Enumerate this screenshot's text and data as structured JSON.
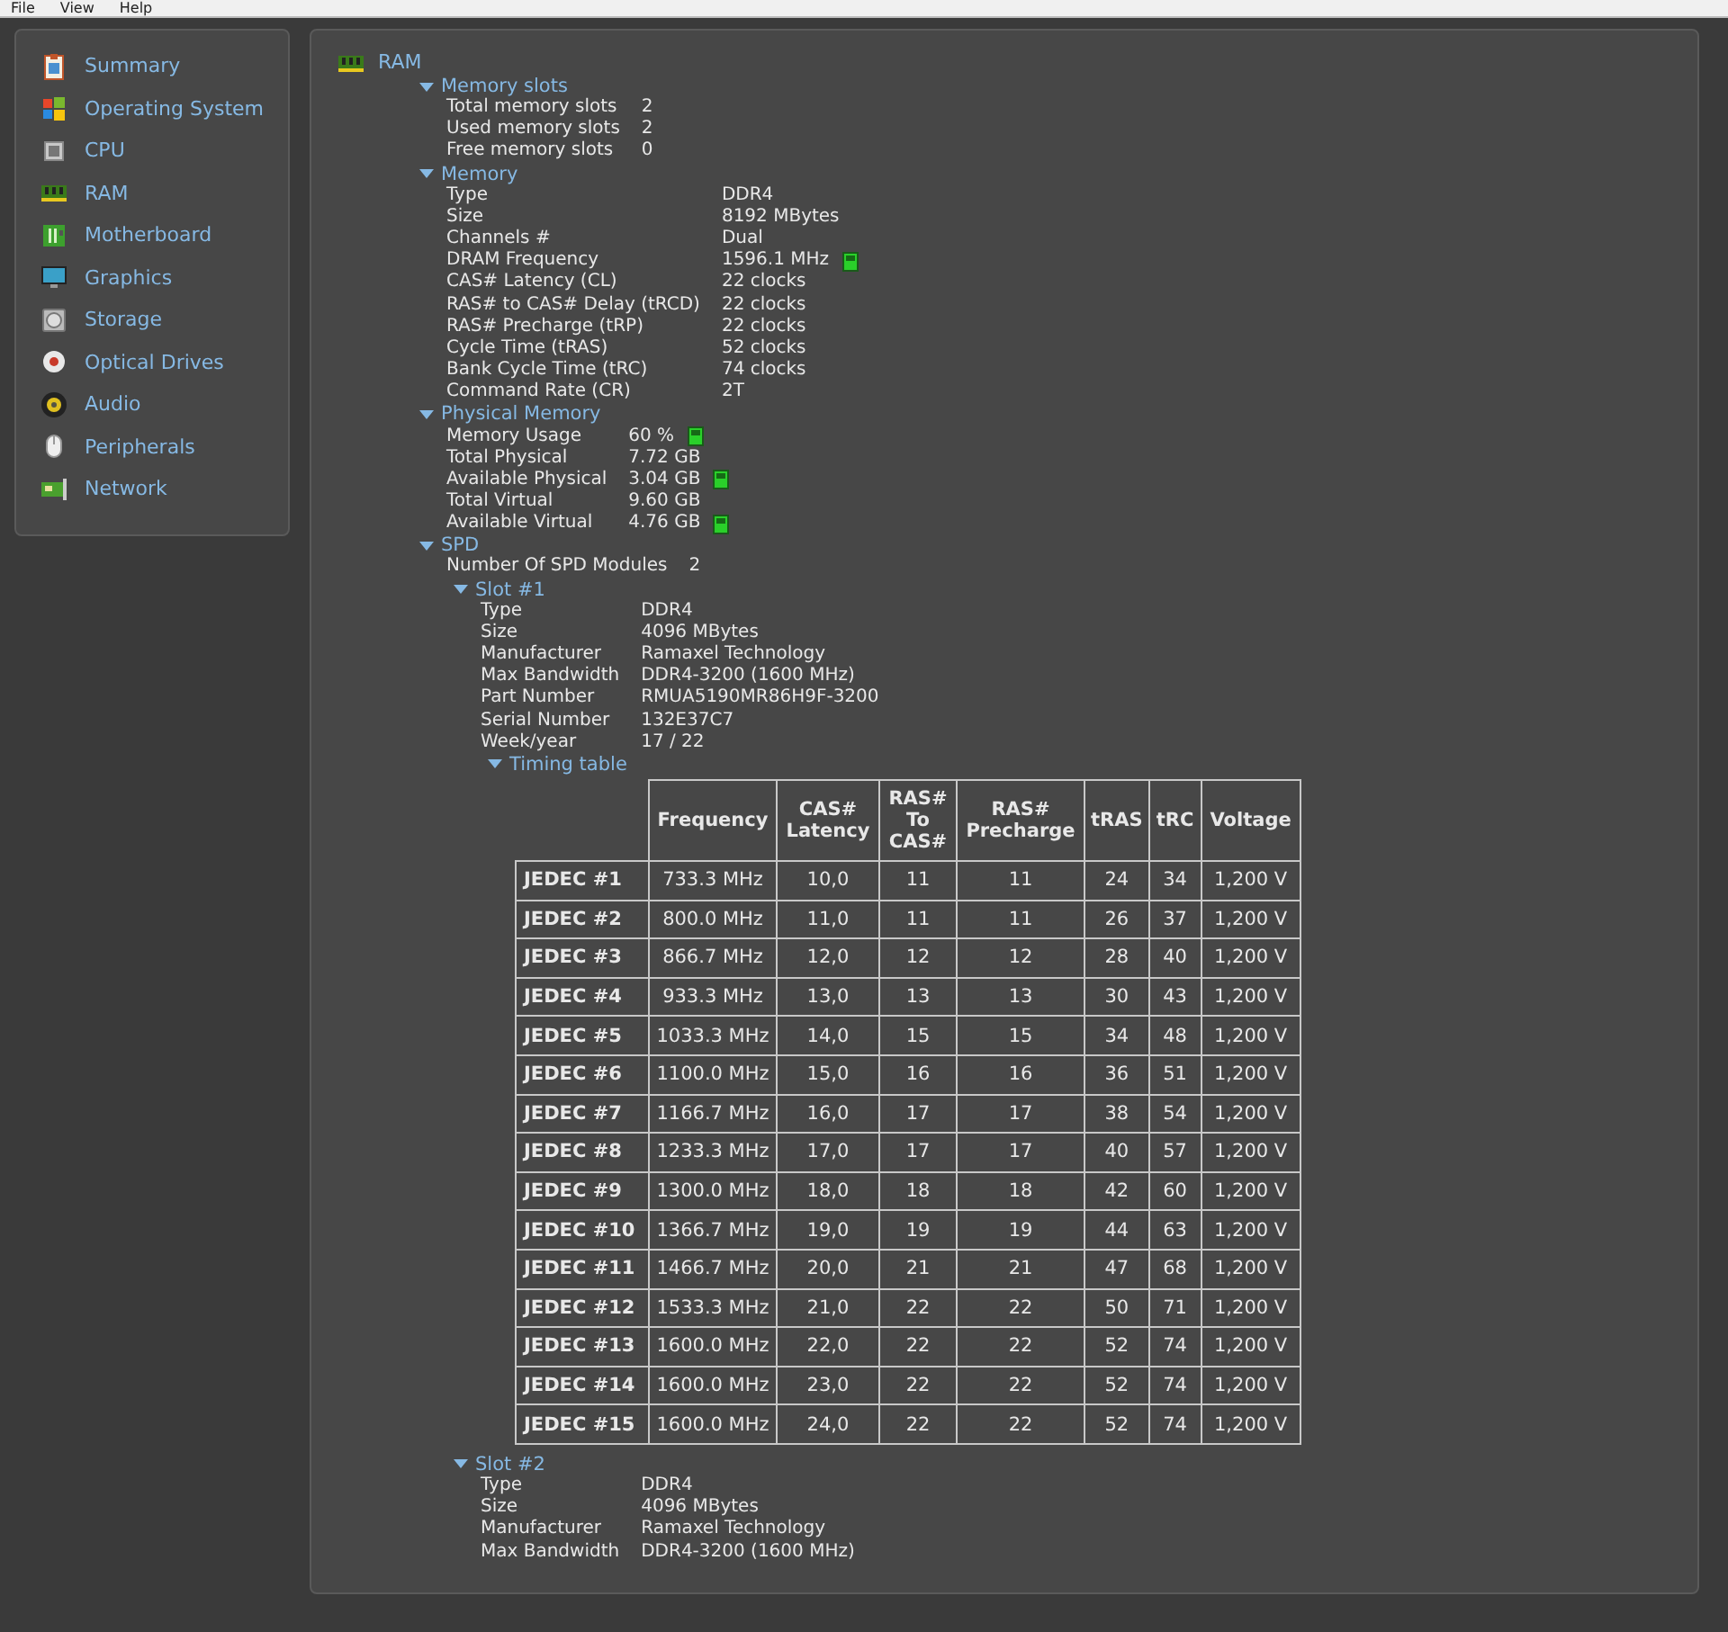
{
  "menu": [
    "File",
    "View",
    "Help"
  ],
  "sidebar": {
    "items": [
      {
        "label": "Summary",
        "kind": "summary"
      },
      {
        "label": "Operating System",
        "kind": "os"
      },
      {
        "label": "CPU",
        "kind": "cpu"
      },
      {
        "label": "RAM",
        "kind": "ram"
      },
      {
        "label": "Motherboard",
        "kind": "motherboard"
      },
      {
        "label": "Graphics",
        "kind": "graphics"
      },
      {
        "label": "Storage",
        "kind": "storage"
      },
      {
        "label": "Optical Drives",
        "kind": "optical"
      },
      {
        "label": "Audio",
        "kind": "audio"
      },
      {
        "label": "Peripherals",
        "kind": "peripherals"
      },
      {
        "label": "Network",
        "kind": "network"
      }
    ]
  },
  "main": {
    "title": "RAM",
    "sections": [
      {
        "title": "Memory slots",
        "expanded": true,
        "rows": [
          {
            "label": "Total memory slots",
            "value": "2"
          },
          {
            "label": "Used memory slots",
            "value": "2"
          },
          {
            "label": "Free memory slots",
            "value": "0"
          }
        ]
      },
      {
        "title": "Memory",
        "expanded": true,
        "rows": [
          {
            "label": "Type",
            "value": "DDR4"
          },
          {
            "label": "Size",
            "value": "8192 MBytes"
          },
          {
            "label": "Channels #",
            "value": "Dual"
          },
          {
            "label": "DRAM Frequency",
            "value": "1596.1 MHz",
            "meter": true
          },
          {
            "label": "CAS# Latency (CL)",
            "value": "22 clocks"
          },
          {
            "label": "RAS# to CAS# Delay (tRCD)",
            "value": "22 clocks"
          },
          {
            "label": "RAS# Precharge (tRP)",
            "value": "22 clocks"
          },
          {
            "label": "Cycle Time (tRAS)",
            "value": "52 clocks"
          },
          {
            "label": "Bank Cycle Time (tRC)",
            "value": "74 clocks"
          },
          {
            "label": "Command Rate (CR)",
            "value": "2T"
          }
        ]
      },
      {
        "title": "Physical Memory",
        "expanded": true,
        "rows": [
          {
            "label": "Memory Usage",
            "value": "60 %",
            "meter": true
          },
          {
            "label": "Total Physical",
            "value": "7.72 GB"
          },
          {
            "label": "Available Physical",
            "value": "3.04 GB",
            "meter": true
          },
          {
            "label": "Total Virtual",
            "value": "9.60 GB"
          },
          {
            "label": "Available Virtual",
            "value": "4.76 GB",
            "meter": true
          }
        ]
      },
      {
        "title": "SPD",
        "expanded": true,
        "rows": [
          {
            "label": "Number Of SPD Modules",
            "value": "2"
          }
        ],
        "children": [
          {
            "title": "Slot #1",
            "expanded": true,
            "rows": [
              {
                "label": "Type",
                "value": "DDR4"
              },
              {
                "label": "Size",
                "value": "4096 MBytes"
              },
              {
                "label": "Manufacturer",
                "value": "Ramaxel Technology"
              },
              {
                "label": "Max Bandwidth",
                "value": "DDR4-3200 (1600 MHz)"
              },
              {
                "label": "Part Number",
                "value": "RMUA5190MR86H9F-3200"
              },
              {
                "label": "Serial Number",
                "value": "132E37C7"
              },
              {
                "label": "Week/year",
                "value": "17 / 22"
              }
            ],
            "children": [
              {
                "title": "Timing table",
                "expanded": true,
                "table": {
                  "columns": [
                    "Frequency",
                    "CAS# Latency",
                    "RAS# To CAS#",
                    "RAS# Precharge",
                    "tRAS",
                    "tRC",
                    "Voltage"
                  ],
                  "rows": [
                    {
                      "name": "JEDEC #1",
                      "cells": [
                        "733.3 MHz",
                        "10,0",
                        "11",
                        "11",
                        "24",
                        "34",
                        "1,200 V"
                      ]
                    },
                    {
                      "name": "JEDEC #2",
                      "cells": [
                        "800.0 MHz",
                        "11,0",
                        "11",
                        "11",
                        "26",
                        "37",
                        "1,200 V"
                      ]
                    },
                    {
                      "name": "JEDEC #3",
                      "cells": [
                        "866.7 MHz",
                        "12,0",
                        "12",
                        "12",
                        "28",
                        "40",
                        "1,200 V"
                      ]
                    },
                    {
                      "name": "JEDEC #4",
                      "cells": [
                        "933.3 MHz",
                        "13,0",
                        "13",
                        "13",
                        "30",
                        "43",
                        "1,200 V"
                      ]
                    },
                    {
                      "name": "JEDEC #5",
                      "cells": [
                        "1033.3 MHz",
                        "14,0",
                        "15",
                        "15",
                        "34",
                        "48",
                        "1,200 V"
                      ]
                    },
                    {
                      "name": "JEDEC #6",
                      "cells": [
                        "1100.0 MHz",
                        "15,0",
                        "16",
                        "16",
                        "36",
                        "51",
                        "1,200 V"
                      ]
                    },
                    {
                      "name": "JEDEC #7",
                      "cells": [
                        "1166.7 MHz",
                        "16,0",
                        "17",
                        "17",
                        "38",
                        "54",
                        "1,200 V"
                      ]
                    },
                    {
                      "name": "JEDEC #8",
                      "cells": [
                        "1233.3 MHz",
                        "17,0",
                        "17",
                        "17",
                        "40",
                        "57",
                        "1,200 V"
                      ]
                    },
                    {
                      "name": "JEDEC #9",
                      "cells": [
                        "1300.0 MHz",
                        "18,0",
                        "18",
                        "18",
                        "42",
                        "60",
                        "1,200 V"
                      ]
                    },
                    {
                      "name": "JEDEC #10",
                      "cells": [
                        "1366.7 MHz",
                        "19,0",
                        "19",
                        "19",
                        "44",
                        "63",
                        "1,200 V"
                      ]
                    },
                    {
                      "name": "JEDEC #11",
                      "cells": [
                        "1466.7 MHz",
                        "20,0",
                        "21",
                        "21",
                        "47",
                        "68",
                        "1,200 V"
                      ]
                    },
                    {
                      "name": "JEDEC #12",
                      "cells": [
                        "1533.3 MHz",
                        "21,0",
                        "22",
                        "22",
                        "50",
                        "71",
                        "1,200 V"
                      ]
                    },
                    {
                      "name": "JEDEC #13",
                      "cells": [
                        "1600.0 MHz",
                        "22,0",
                        "22",
                        "22",
                        "52",
                        "74",
                        "1,200 V"
                      ]
                    },
                    {
                      "name": "JEDEC #14",
                      "cells": [
                        "1600.0 MHz",
                        "23,0",
                        "22",
                        "22",
                        "52",
                        "74",
                        "1,200 V"
                      ]
                    },
                    {
                      "name": "JEDEC #15",
                      "cells": [
                        "1600.0 MHz",
                        "24,0",
                        "22",
                        "22",
                        "52",
                        "74",
                        "1,200 V"
                      ]
                    }
                  ]
                }
              }
            ]
          },
          {
            "title": "Slot #2",
            "expanded": true,
            "rows": [
              {
                "label": "Type",
                "value": "DDR4"
              },
              {
                "label": "Size",
                "value": "4096 MBytes"
              },
              {
                "label": "Manufacturer",
                "value": "Ramaxel Technology"
              },
              {
                "label": "Max Bandwidth",
                "value": "DDR4-3200 (1600 MHz)"
              }
            ]
          }
        ]
      }
    ]
  }
}
